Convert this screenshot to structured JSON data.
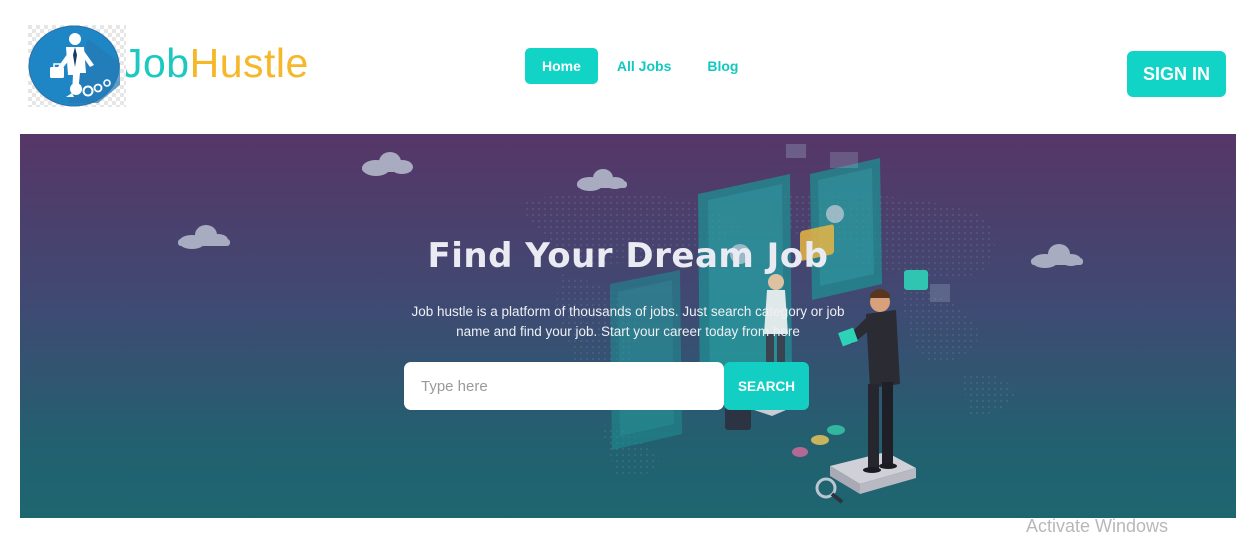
{
  "header": {
    "logo": {
      "part1": "Job",
      "part2": "Hustle",
      "icon": "businessman-logo-icon"
    },
    "nav": [
      {
        "label": "Home",
        "active": true
      },
      {
        "label": "All Jobs",
        "active": false
      },
      {
        "label": "Blog",
        "active": false
      }
    ],
    "signin_label": "SIGN IN"
  },
  "hero": {
    "title": "Find Your Dream Job",
    "description": "Job hustle is a platform of thousands of jobs. Just search category or job name and find your job. Start your career today from here",
    "search": {
      "placeholder": "Type here",
      "value": "",
      "button_label": "SEARCH"
    }
  },
  "system": {
    "watermark": "Activate Windows"
  },
  "colors": {
    "accent": "#11d3c6",
    "logo_yellow": "#f6b82b",
    "hero_top": "#563667",
    "hero_bottom": "#1d6670"
  }
}
